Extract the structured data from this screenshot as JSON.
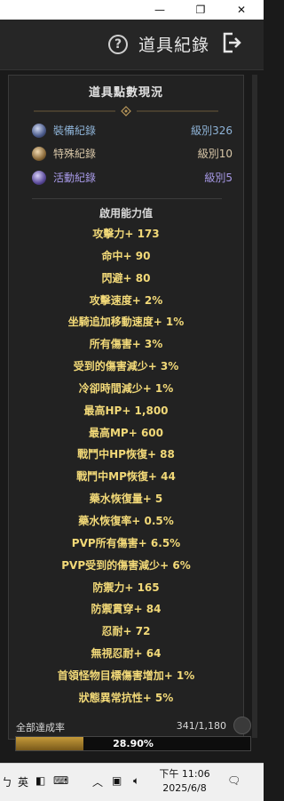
{
  "window": {
    "minimize_glyph": "—",
    "restore_glyph": "❐",
    "close_glyph": "✕"
  },
  "header": {
    "title": "道具紀錄",
    "help_icon": "question-circle-icon",
    "exit_icon": "exit-door-icon"
  },
  "panel": {
    "title": "道具點數現況",
    "categories": [
      {
        "label": "裝備紀錄",
        "level": "級別326",
        "color": "#8fb4d8",
        "icon": "equipment-orb-icon"
      },
      {
        "label": "特殊紀錄",
        "level": "級別10",
        "color": "#d8c7a8",
        "icon": "special-orb-icon"
      },
      {
        "label": "活動紀錄",
        "level": "級別5",
        "color": "#a89ae8",
        "icon": "event-orb-icon"
      }
    ],
    "ability_title": "啟用能力值",
    "stats": [
      "攻擊力+ 173",
      "命中+ 90",
      "閃避+ 80",
      "攻擊速度+ 2%",
      "坐騎追加移動速度+ 1%",
      "所有傷害+ 3%",
      "受到的傷害減少+ 3%",
      "冷卻時間減少+ 1%",
      "最高HP+ 1,800",
      "最高MP+ 600",
      "戰鬥中HP恢復+ 88",
      "戰鬥中MP恢復+ 44",
      "藥水恢復量+ 5",
      "藥水恢復率+ 0.5%",
      "PVP所有傷害+ 6.5%",
      "PVP受到的傷害減少+ 6%",
      "防禦力+ 165",
      "防禦貫穿+ 84",
      "忍耐+ 72",
      "無視忍耐+ 64",
      "首領怪物目標傷害增加+ 1%",
      "狀態異常抗性+ 5%"
    ]
  },
  "completion": {
    "label": "全部達成率",
    "count": "341/1,180",
    "percent_text": "28.90%",
    "fraction": 0.289
  },
  "taskbar": {
    "ime_mode": "英",
    "time": "下午 11:06",
    "date": "2025/6/8"
  },
  "colors": {
    "stat_text": "#f2d978",
    "progress_fill": "#c59a3a"
  }
}
